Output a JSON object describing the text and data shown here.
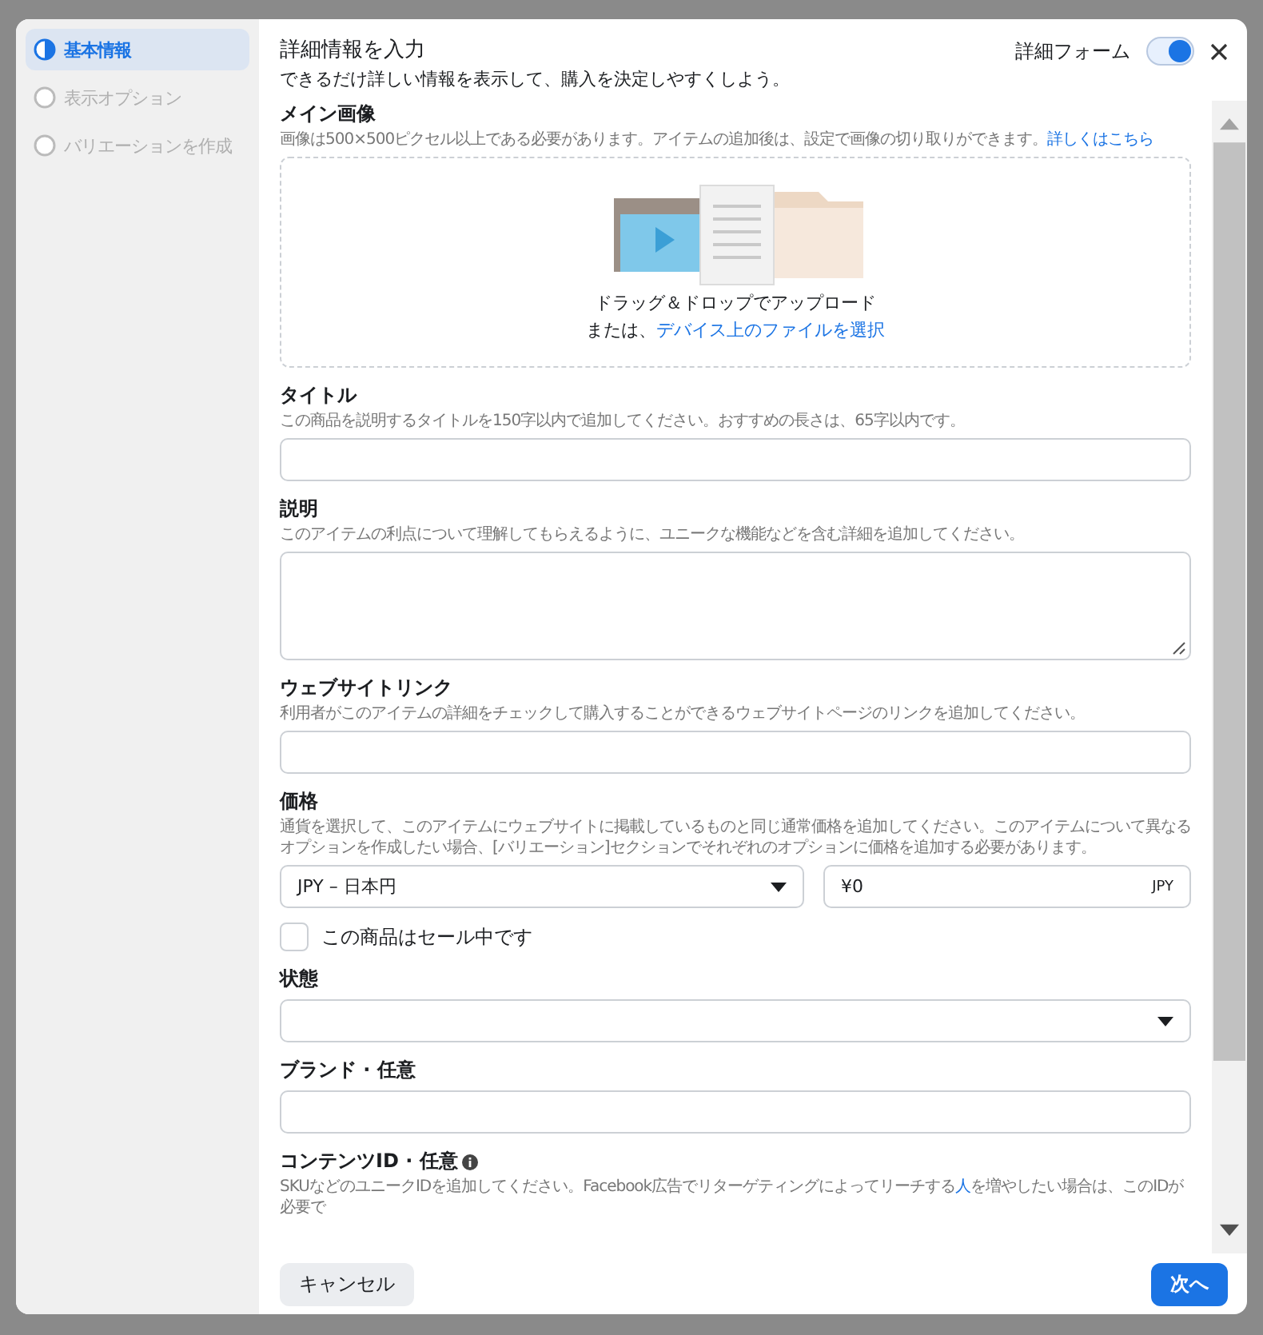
{
  "sidebar": {
    "steps": [
      {
        "label": "基本情報",
        "selected": true
      },
      {
        "label": "表示オプション",
        "selected": false
      },
      {
        "label": "バリエーションを作成",
        "selected": false
      }
    ]
  },
  "header": {
    "title": "詳細情報を入力",
    "subtitle": "できるだけ詳しい情報を表示して、購入を決定しやすくしよう。",
    "toggle": {
      "label": "詳細フォーム",
      "on": true
    }
  },
  "fields": [
    {
      "kind": "upload",
      "label": "メイン画像",
      "description": [
        {
          "text": "画像は500×500ピクセル以上である必要があります。アイテムの追加後は、設定で画像の切り取りができます。",
          "link": false
        },
        {
          "text": "詳しくはこちら",
          "link": true
        }
      ],
      "drop_text": "ドラッグ＆ドロップでアップロード",
      "or_text": "または、",
      "select_link": "デバイス上のファイルを選択"
    },
    {
      "kind": "text",
      "label": "タイトル",
      "description": [
        {
          "text": "この商品を説明するタイトルを150字以内で追加してください。おすすめの長さは、65字以内です。",
          "link": false
        }
      ]
    },
    {
      "kind": "textarea",
      "label": "説明",
      "description": [
        {
          "text": "このアイテムの利点について理解してもらえるように、ユニークな機能などを含む詳細を追加してください。",
          "link": false
        }
      ]
    },
    {
      "kind": "text",
      "label": "ウェブサイトリンク",
      "description": [
        {
          "text": "利用者がこのアイテムの詳細をチェックして購入することができるウェブサイトページのリンクを追加してください。",
          "link": false
        }
      ]
    },
    {
      "kind": "price",
      "label": "価格",
      "description": [
        {
          "text": "通貨を選択して、このアイテムにウェブサイトに掲載しているものと同じ通常価格を追加してください。このアイテムについて異なるオプションを作成したい場合、[バリエーション]セクションでそれぞれのオプションに価格を追加する必要があります。",
          "link": false
        }
      ],
      "currency": "JPY – 日本円",
      "price": "¥0",
      "unit": "JPY"
    },
    {
      "kind": "checkbox",
      "label": "この商品はセール中です",
      "checked": false
    },
    {
      "kind": "select",
      "label": "状態"
    },
    {
      "kind": "text",
      "label": "ブランド · 任意"
    },
    {
      "kind": "info",
      "label": "コンテンツID · 任意",
      "description": [
        {
          "text": "SKUなどのユニークIDを追加してください。Facebook広告でリターゲティングによってリーチする",
          "link": false
        },
        {
          "text": "人",
          "link": true
        },
        {
          "text": "を増やしたい場合は、このIDが必要で",
          "link": false
        }
      ]
    }
  ],
  "footer": {
    "cancel": "キャンセル",
    "next": "次へ"
  }
}
